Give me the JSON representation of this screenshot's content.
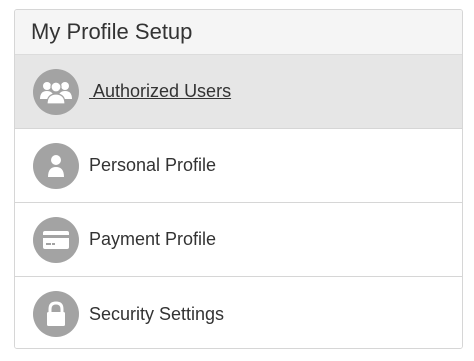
{
  "panel": {
    "title": "My Profile Setup"
  },
  "menu": {
    "items": [
      {
        "label": " Authorized Users",
        "icon": "users-icon",
        "active": true
      },
      {
        "label": "Personal Profile",
        "icon": "person-icon",
        "active": false
      },
      {
        "label": "Payment Profile",
        "icon": "credit-card-icon",
        "active": false
      },
      {
        "label": "Security Settings",
        "icon": "lock-icon",
        "active": false
      }
    ]
  },
  "colors": {
    "icon_background": "#a3a3a3",
    "active_row": "#e6e6e6",
    "header_background": "#f5f5f5",
    "text": "#333333"
  }
}
